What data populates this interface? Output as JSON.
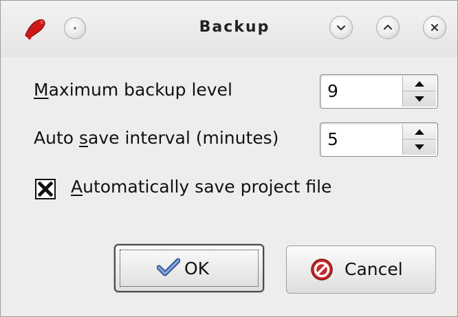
{
  "window": {
    "title": "Backup",
    "icons": {
      "app": "red-paw-app-icon",
      "menu": "window-menu-icon",
      "minimize": "chevron-down-icon",
      "maximize": "chevron-up-icon",
      "close": "close-x-icon"
    }
  },
  "form": {
    "max_backup": {
      "mnemonic": "M",
      "label_rest": "aximum backup level",
      "value": "9"
    },
    "autosave": {
      "label_pre": "Auto ",
      "mnemonic": "s",
      "label_post": "ave interval (minutes)",
      "value": "5"
    },
    "autosave_project": {
      "mnemonic": "A",
      "label_rest": "utomatically save project file",
      "checked": true
    }
  },
  "buttons": {
    "ok_label": "OK",
    "cancel_label": "Cancel"
  },
  "colors": {
    "ok_check": "#4a72b5",
    "cancel_icon": "#c6282c",
    "app_icon": "#d01818"
  }
}
